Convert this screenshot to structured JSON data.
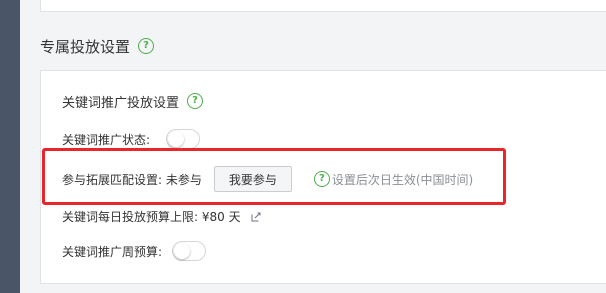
{
  "section": {
    "title": "专属投放设置"
  },
  "keyword": {
    "settings_title": "关键词推广投放设置",
    "status_label": "关键词推广状态:",
    "status_on": false,
    "expand_label": "参与拓展匹配设置: 未参与",
    "join_button": "我要参与",
    "tip": "设置后次日生效(中国时间)",
    "daily_budget_label": "关键词每日投放预算上限: ¥80 天",
    "weekly_budget_label": "关键词推广周预算:",
    "weekly_on": false
  },
  "colors": {
    "help_icon": "#4cae4c",
    "highlight": "#e8262b"
  },
  "icons": {
    "help": "question-circle-icon",
    "edit": "edit-icon"
  }
}
